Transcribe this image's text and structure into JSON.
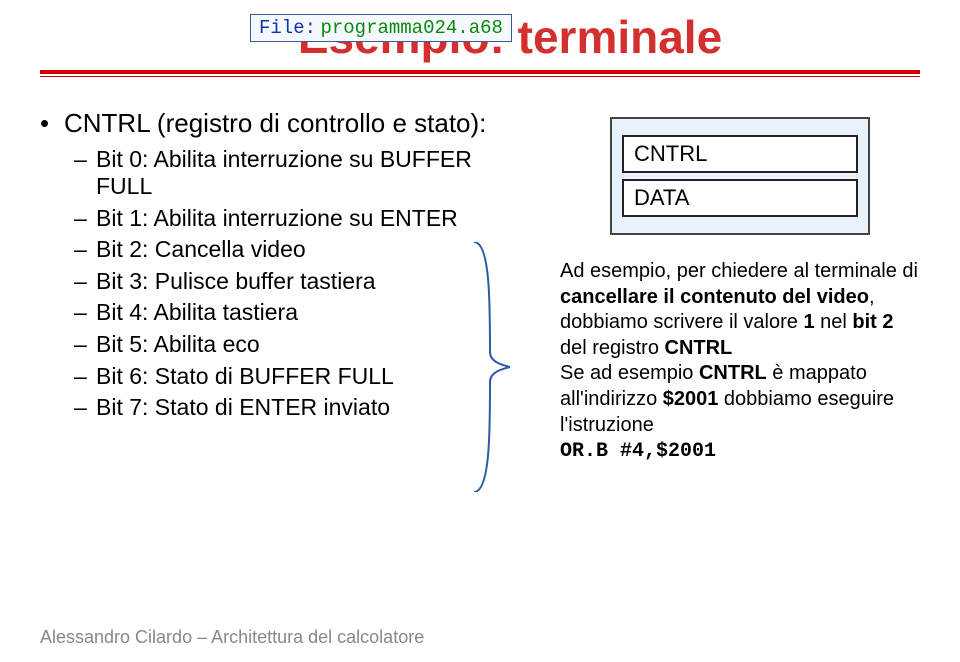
{
  "title": "Esempio: terminale",
  "file_label": {
    "key": "File:",
    "value": "programma024.a68"
  },
  "main_bullet": "CNTRL (registro di controllo e stato):",
  "sub_bullets": [
    "Bit 0: Abilita interruzione su BUFFER FULL",
    "Bit 1: Abilita interruzione su ENTER",
    "Bit 2: Cancella video",
    "Bit 3: Pulisce buffer tastiera",
    "Bit 4: Abilita tastiera",
    "Bit 5: Abilita eco",
    "Bit 6: Stato di BUFFER FULL",
    "Bit 7: Stato di ENTER inviato"
  ],
  "registers": {
    "r1": "CNTRL",
    "r2": "DATA"
  },
  "desc": {
    "l1a": "Ad esempio, per chiedere al terminale di ",
    "l1b": "cancellare il contenuto del video",
    "l1c": ", dobbiamo scrivere il valore ",
    "v1": "1",
    "l1d": " nel ",
    "v2": "bit 2",
    "l1e": " del registro ",
    "v3": "CNTRL",
    "l2a": "Se ad esempio ",
    "v4": "CNTRL",
    "l2b": " è mappato all'indirizzo ",
    "v5": "$2001",
    "l2c": " dobbiamo eseguire l'istruzione",
    "code": "OR.B #4,$2001"
  },
  "footer": "Alessandro Cilardo – Architettura del calcolatore"
}
